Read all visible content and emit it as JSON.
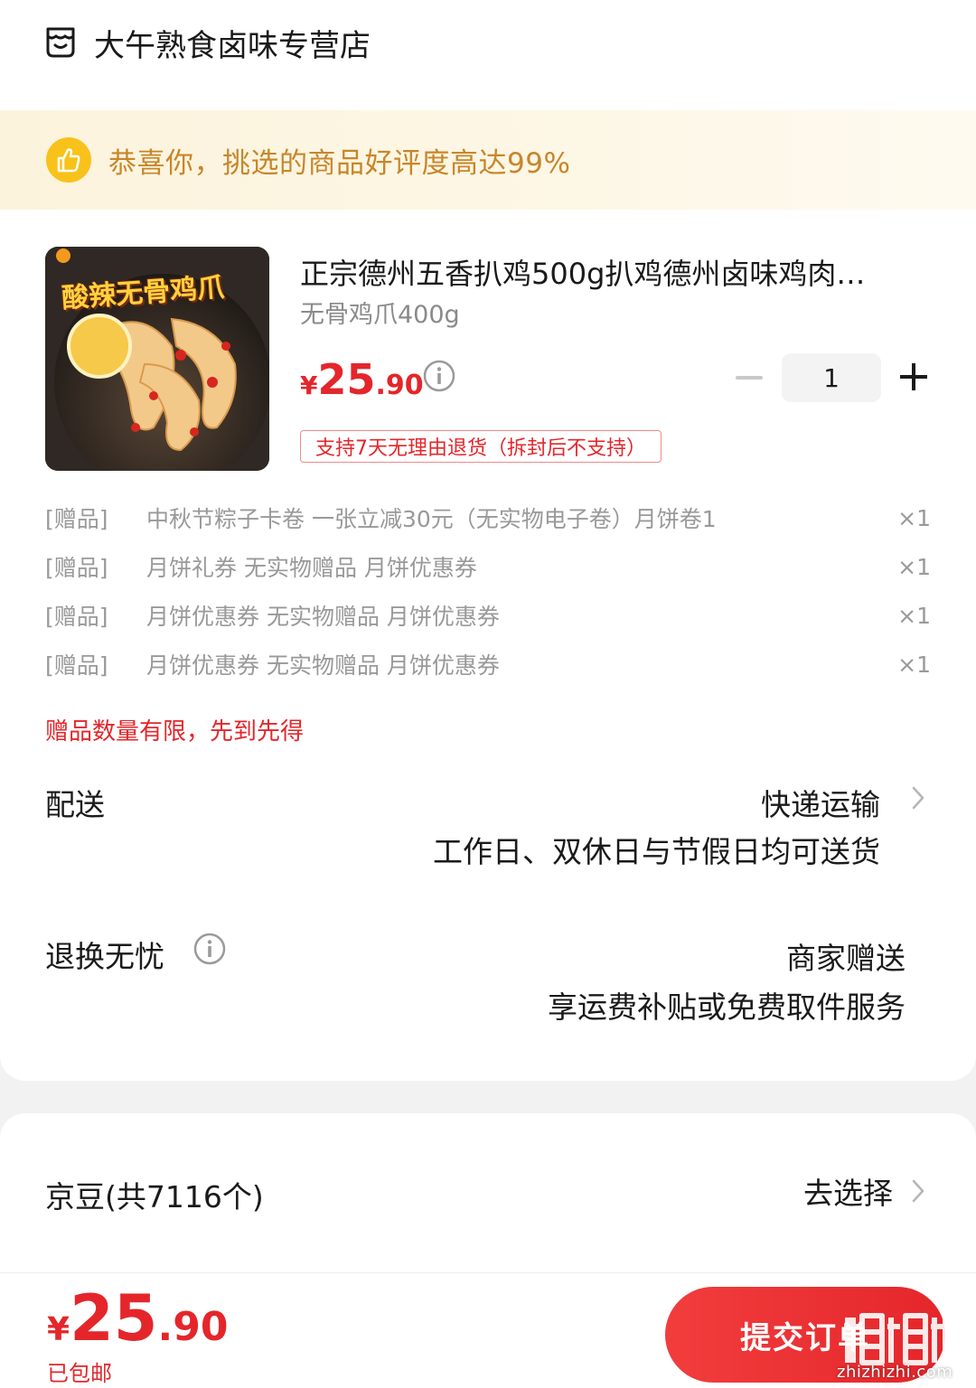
{
  "store": {
    "name": "大午熟食卤味专营店",
    "icon": "store-icon"
  },
  "banner": {
    "text": "恭喜你，挑选的商品好评度高达99%",
    "icon": "thumbs-up-icon"
  },
  "product": {
    "image_text": "酸辣无骨鸡爪",
    "title": "正宗德州五香扒鸡500g扒鸡德州卤味鸡肉…",
    "spec": "无骨鸡爪400g",
    "price": {
      "currency": "¥",
      "integer": "25",
      "decimal": ".90"
    },
    "quantity": "1",
    "return_tag": "支持7天无理由退货（拆封后不支持）"
  },
  "gifts": [
    {
      "tag": "[赠品]",
      "name": "中秋节粽子卡卷 一张立减30元（无实物电子卷）月饼卷1",
      "qty": "×1"
    },
    {
      "tag": "[赠品]",
      "name": "月饼礼券 无实物赠品 月饼优惠券",
      "qty": "×1"
    },
    {
      "tag": "[赠品]",
      "name": "月饼优惠券  无实物赠品 月饼优惠券",
      "qty": "×1"
    },
    {
      "tag": "[赠品]",
      "name": "月饼优惠券 无实物赠品 月饼优惠券",
      "qty": "×1"
    }
  ],
  "gift_note": "赠品数量有限，先到先得",
  "delivery": {
    "label": "配送",
    "method": "快递运输",
    "detail": "工作日、双休日与节假日均可送货"
  },
  "returns": {
    "label": "退换无忧",
    "value": "商家赠送",
    "detail": "享运费补贴或免费取件服务"
  },
  "jingdou": {
    "label": "京豆(共7116个)",
    "action": "去选择"
  },
  "footer": {
    "total": {
      "currency": "¥",
      "integer": "25",
      "decimal": ".90"
    },
    "shipping": "已包邮",
    "submit_label": "提交订单",
    "watermark": "zhizhizhi.com"
  },
  "colors": {
    "accent": "#e4262b",
    "banner_text": "#c8862a",
    "banner_bg": "#fcf3dc"
  }
}
